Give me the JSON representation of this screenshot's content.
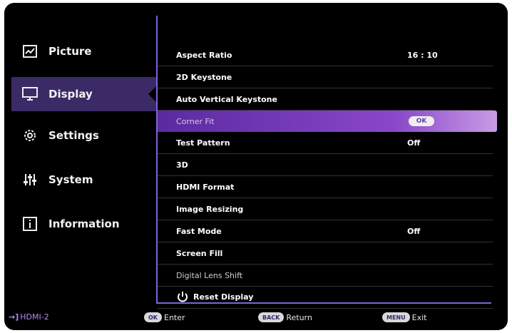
{
  "sidebar": {
    "items": [
      {
        "label": "Picture",
        "icon": "picture-icon",
        "active": false
      },
      {
        "label": "Display",
        "icon": "display-icon",
        "active": true
      },
      {
        "label": "Settings",
        "icon": "gear-icon",
        "active": false
      },
      {
        "label": "System",
        "icon": "sliders-icon",
        "active": false
      },
      {
        "label": "Information",
        "icon": "info-icon",
        "active": false
      }
    ]
  },
  "menu": {
    "rows": [
      {
        "label": "Aspect Ratio",
        "value": "16 : 10"
      },
      {
        "label": "2D Keystone",
        "value": ""
      },
      {
        "label": "Auto Vertical Keystone",
        "value": ""
      },
      {
        "label": "Corner Fit",
        "value": "OK",
        "selected": true
      },
      {
        "label": "Test Pattern",
        "value": "Off"
      },
      {
        "label": "3D",
        "value": ""
      },
      {
        "label": "HDMI Format",
        "value": ""
      },
      {
        "label": "Image Resizing",
        "value": ""
      },
      {
        "label": "Fast Mode",
        "value": "Off"
      },
      {
        "label": "Screen Fill",
        "value": ""
      },
      {
        "label": "Digital Lens Shift",
        "value": "",
        "dim": true
      },
      {
        "label": "Reset Display",
        "value": "",
        "icon": "reset-icon"
      }
    ]
  },
  "footer": {
    "source": "HDMI-2",
    "ok_key": "OK",
    "ok_label": "Enter",
    "back_key": "BACK",
    "back_label": "Return",
    "menu_key": "MENU",
    "menu_label": "Exit"
  },
  "colors": {
    "accent": "#7d64d6",
    "active_bg": "#3b2a66",
    "highlight": "#8a47c9"
  }
}
